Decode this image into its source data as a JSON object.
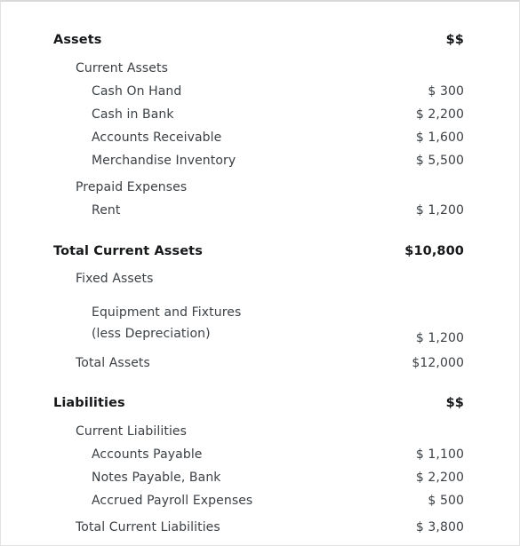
{
  "document": {
    "type": "balance-sheet",
    "currency_symbol": "$",
    "header_value": "$$"
  },
  "sections": [
    {
      "id": "assets",
      "heading": "Assets",
      "heading_value": "$$",
      "rows": [
        {
          "id": "current-assets",
          "label": "Current Assets",
          "value": "",
          "level": 1,
          "style": "normal",
          "gap": "gap-sub"
        },
        {
          "id": "cash-on-hand",
          "label": "Cash On Hand",
          "value": "$ 300",
          "level": 2,
          "style": "normal",
          "gap": "gap-item"
        },
        {
          "id": "cash-in-bank",
          "label": "Cash in Bank",
          "value": "$ 2,200",
          "level": 2,
          "style": "normal",
          "gap": "gap-item"
        },
        {
          "id": "accounts-receivable",
          "label": "Accounts Receivable",
          "value": "$ 1,600",
          "level": 2,
          "style": "normal",
          "gap": "gap-item"
        },
        {
          "id": "merchandise-inventory",
          "label": "Merchandise Inventory",
          "value": "$ 5,500",
          "level": 2,
          "style": "normal",
          "gap": "gap-item"
        },
        {
          "id": "prepaid-expenses",
          "label": "Prepaid Expenses",
          "value": "",
          "level": 1,
          "style": "normal",
          "gap": "gap-group"
        },
        {
          "id": "rent",
          "label": "Rent",
          "value": "$ 1,200",
          "level": 2,
          "style": "normal",
          "gap": "gap-item"
        },
        {
          "id": "total-current-assets",
          "label": "Total Current Assets",
          "value": "$10,800",
          "level": 0,
          "style": "total-strong",
          "gap": "gap-total"
        },
        {
          "id": "fixed-assets",
          "label": "Fixed Assets",
          "value": "",
          "level": 1,
          "style": "normal",
          "gap": "gap-sub"
        },
        {
          "id": "equipment-and-fixtures",
          "label": "Equipment and Fixtures\n(less Depreciation)",
          "value": "$ 1,200",
          "level": 2,
          "style": "normal",
          "gap": "gap-twoline",
          "twoline": true
        },
        {
          "id": "total-assets",
          "label": "Total Assets",
          "value": "$12,000",
          "level": 1,
          "style": "normal",
          "gap": "gap-after2l"
        }
      ]
    },
    {
      "id": "liabilities",
      "heading": "Liabilities",
      "heading_value": "$$",
      "rows": [
        {
          "id": "current-liabilities",
          "label": "Current Liabilities",
          "value": "",
          "level": 1,
          "style": "normal",
          "gap": "gap-sub"
        },
        {
          "id": "accounts-payable",
          "label": "Accounts Payable",
          "value": "$ 1,100",
          "level": 2,
          "style": "normal",
          "gap": "gap-item"
        },
        {
          "id": "notes-payable-bank",
          "label": "Notes Payable, Bank",
          "value": "$ 2,200",
          "level": 2,
          "style": "normal",
          "gap": "gap-item"
        },
        {
          "id": "accrued-payroll-expenses",
          "label": "Accrued Payroll Expenses",
          "value": "$ 500",
          "level": 2,
          "style": "normal",
          "gap": "gap-item"
        },
        {
          "id": "total-current-liabilities",
          "label": "Total Current Liabilities",
          "value": "$ 3,800",
          "level": 1,
          "style": "normal",
          "gap": "gap-group"
        }
      ]
    }
  ],
  "colors": {
    "heading_text": "#16181a",
    "body_text": "#3b4045",
    "page_background": "#ffffff",
    "page_border": "#e2e2e2"
  }
}
